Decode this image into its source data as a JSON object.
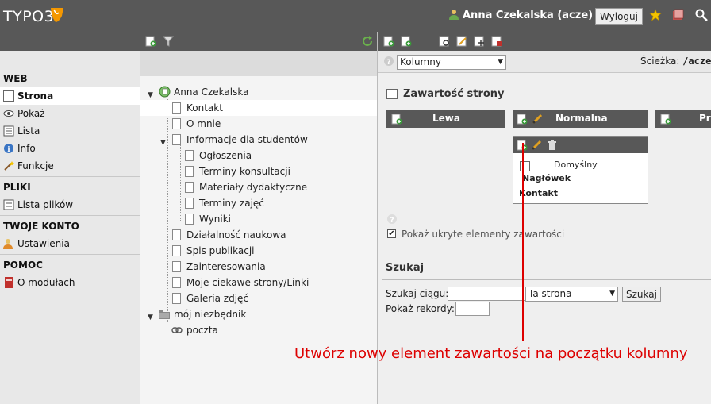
{
  "app": {
    "logo_text": "TYPO3"
  },
  "header": {
    "user_name": "Anna Czekalska (acze)",
    "logout_label": "Wyloguj"
  },
  "modules": {
    "sections": [
      {
        "title": "WEB",
        "items": [
          "Strona",
          "Pokaż",
          "Lista",
          "Info",
          "Funkcje"
        ]
      },
      {
        "title": "PLIKI",
        "items": [
          "Lista plików"
        ]
      },
      {
        "title": "TWOJE KONTO",
        "items": [
          "Ustawienia"
        ]
      },
      {
        "title": "POMOC",
        "items": [
          "O modułach"
        ]
      }
    ],
    "active": "Strona"
  },
  "tree": {
    "root": "Anna Czekalska",
    "nodes": [
      "Kontakt",
      "O mnie",
      "Informacje dla studentów",
      "Ogłoszenia",
      "Terminy konsultacji",
      "Materiały dydaktyczne",
      "Terminy zajęć",
      "Wyniki",
      "Działalność naukowa",
      "Spis publikacji",
      "Zainteresowania",
      "Moje ciekawe strony/Linki",
      "Galeria zdjęć",
      "mój niezbędnik",
      "poczta"
    ],
    "selected": "Kontakt"
  },
  "main": {
    "view_select": "Kolumny",
    "path_label": "Ścieżka:",
    "path_value": "/acze",
    "section_title": "Zawartość strony",
    "columns": [
      "Lewa",
      "Normalna",
      "Pr"
    ],
    "element": {
      "type": "Domyślny",
      "header_label": "Nagłówek",
      "header_value": "Kontakt"
    },
    "show_hidden_label": "Pokaż ukryte elementy zawartości",
    "search": {
      "title": "Szukaj",
      "string_label": "Szukaj ciągu:",
      "scope_value": "Ta strona",
      "button": "Szukaj",
      "records_label": "Pokaż rekordy:"
    }
  },
  "annotation": "Utwórz nowy element zawartości na początku kolumny",
  "colors": {
    "bar": "#585858",
    "accent": "#f49700",
    "annotation": "#dd0000"
  }
}
